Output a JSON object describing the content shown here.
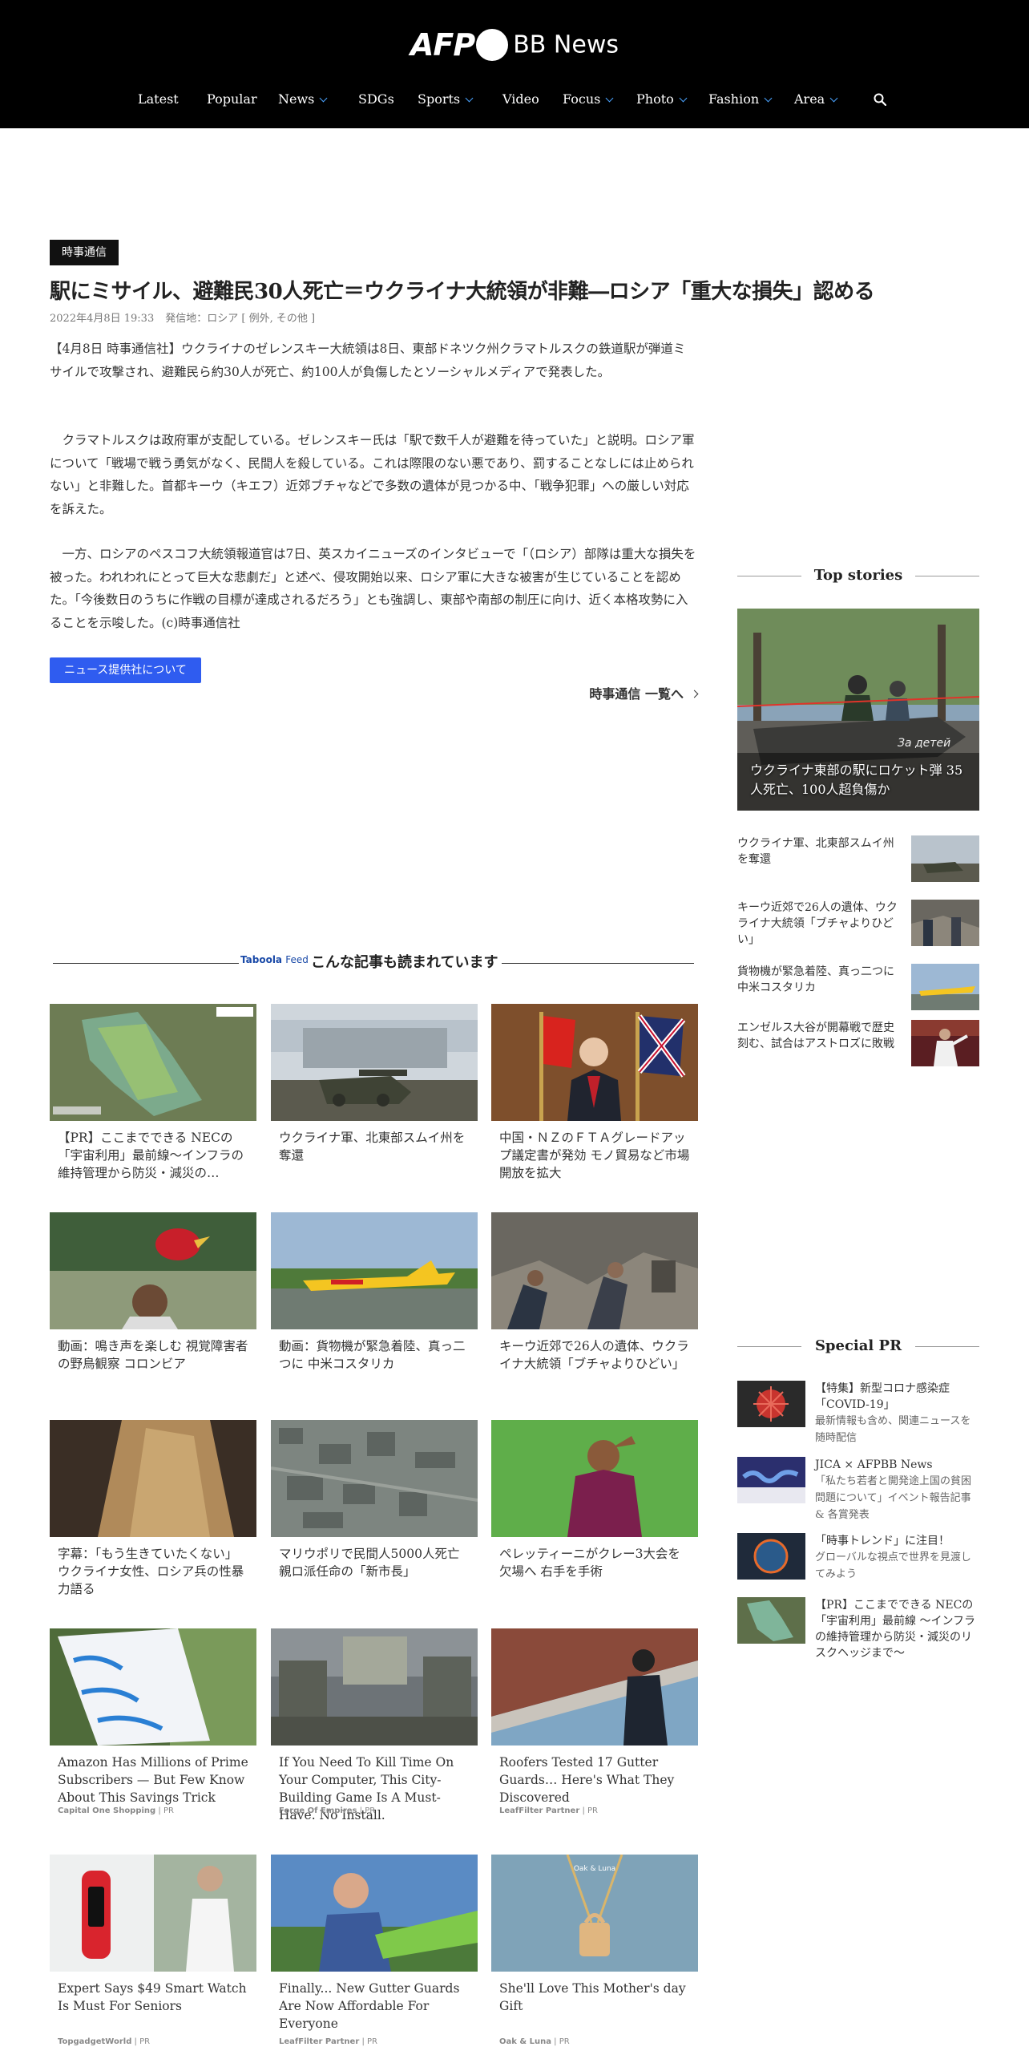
{
  "header": {
    "logo_afp": "AFP",
    "logo_bb": "BB News",
    "nav": [
      {
        "label": "Latest",
        "dropdown": false
      },
      {
        "label": "Popular",
        "dropdown": false
      },
      {
        "label": "News",
        "dropdown": true
      },
      {
        "label": "SDGs",
        "dropdown": false
      },
      {
        "label": "Sports",
        "dropdown": true
      },
      {
        "label": "Video",
        "dropdown": false
      },
      {
        "label": "Focus",
        "dropdown": true
      },
      {
        "label": "Photo",
        "dropdown": true
      },
      {
        "label": "Fashion",
        "dropdown": true
      },
      {
        "label": "Area",
        "dropdown": true
      }
    ],
    "search_icon": "search-icon"
  },
  "article": {
    "badge": "時事通信",
    "headline": "駅にミサイル、避難民30人死亡＝ウクライナ大統領が非難―ロシア「重大な損失」認める",
    "date": "2022年4月8日 19:33",
    "origin": "発信地：ロシア [ 例外, その他 ]",
    "paragraphs": [
      "【4月8日 時事通信社】ウクライナのゼレンスキー大統領は8日、東部ドネツク州クラマトルスクの鉄道駅が弾道ミサイルで攻撃され、避難民ら約30人が死亡、約100人が負傷したとソーシャルメディアで発表した。",
      "　クラマトルスクは政府軍が支配している。ゼレンスキー氏は「駅で数千人が避難を待っていた」と説明。ロシア軍について「戦場で戦う勇気がなく、民間人を殺している。これは際限のない悪であり、罰することなしには止められない」と非難した。首都キーウ（キエフ）近郊ブチャなどで多数の遺体が見つかる中、「戦争犯罪」への厳しい対応を訴えた。",
      "　一方、ロシアのペスコフ大統領報道官は7日、英スカイニューズのインタビューで「（ロシア）部隊は重大な損失を被った。われわれにとって巨大な悲劇だ」と述べ、侵攻開始以来、ロシア軍に大きな被害が生じていることを認めた。「今後数日のうちに作戦の目標が達成されるだろう」とも強調し、東部や南部の制圧に向け、近く本格攻勢に入ることを示唆した。(c)時事通信社"
    ],
    "provider_button": "ニュース提供社について",
    "list_link": "時事通信 一覧へ"
  },
  "feed": {
    "brand": "Taboola",
    "brand_suffix": "Feed",
    "title": "こんな記事も読まれています",
    "cards": [
      {
        "title": "【PR】ここまでできる NECの「宇宙利用」最前線～インフラの維持管理から防災・減災の…",
        "source": "",
        "thumb": "satellite-map"
      },
      {
        "title": "ウクライナ軍、北東部スムイ州を奪還",
        "source": "",
        "thumb": "tank"
      },
      {
        "title": "中国・ＮＺのＦＴＡグレードアップ議定書が発効 モノ貿易など市場開放を拡大",
        "source": "",
        "thumb": "official-flags"
      },
      {
        "title": "動画：鳴き声を楽しむ 視覚障害者の野鳥観察 コロンビア",
        "source": "",
        "thumb": "bird-boy"
      },
      {
        "title": "動画：貨物機が緊急着陸、真っ二つに 中米コスタリカ",
        "source": "",
        "thumb": "cargo-plane"
      },
      {
        "title": "キーウ近郊で26人の遺体、ウクライナ大統領「ブチャよりひどい」",
        "source": "",
        "thumb": "rubble"
      },
      {
        "title": "字幕：「もう生きていたくない」 ウクライナ女性、ロシア兵の性暴力語る",
        "source": "",
        "thumb": "woman-back"
      },
      {
        "title": "マリウポリで民間人5000人死亡 親ロ派任命の「新市長」",
        "source": "",
        "thumb": "aerial-city"
      },
      {
        "title": "ペレッティーニがクレー3大会を欠場へ 右手を手術",
        "source": "",
        "thumb": "tennis"
      },
      {
        "title": "Amazon Has Millions of Prime Subscribers — But Few Know About This Savings Trick",
        "source": "Capital One Shopping",
        "tag": "PR",
        "thumb": "prime-box"
      },
      {
        "title": "If You Need To Kill Time On Your Computer, This City-Building Game Is A Must-Have. No Install.",
        "source": "Forge Of Empires",
        "tag": "PR",
        "thumb": "game-city"
      },
      {
        "title": "Roofers Tested 17 Gutter Guards… Here's What They Discovered",
        "source": "LeafFilter Partner",
        "tag": "PR",
        "thumb": "roof"
      },
      {
        "title": "Expert Says $49 Smart Watch Is Must For Seniors",
        "source": "TopgadgetWorld",
        "tag": "PR",
        "thumb": "watch"
      },
      {
        "title": "Finally... New Gutter Guards Are Now Affordable For Everyone",
        "source": "LeafFilter Partner",
        "tag": "PR",
        "thumb": "gutter-man"
      },
      {
        "title": "She'll Love This Mother's day Gift",
        "source": "Oak & Luna",
        "tag": "PR",
        "thumb": "necklace",
        "thumb_text": "Oak & Luna"
      }
    ]
  },
  "sidebar": {
    "top_heading": "Top stories",
    "hero_caption": "ウクライナ東部の駅にロケット弾 35人死亡、100人超負傷か",
    "hero_graffiti": "За детей",
    "top_items": [
      {
        "title": "ウクライナ軍、北東部スムイ州を奪還"
      },
      {
        "title": "キーウ近郊で26人の遺体、ウクライナ大統領「ブチャよりひどい」"
      },
      {
        "title": "貨物機が緊急着陸、真っ二つに 中米コスタリカ"
      },
      {
        "title": "エンゼルス大谷が開幕戦で歴史刻む、試合はアストロズに敗戦"
      }
    ],
    "pr_heading": "Special PR",
    "pr_items": [
      {
        "title": "【特集】新型コロナ感染症「COVID-19」",
        "desc": "最新情報も含め、関連ニュースを随時配信"
      },
      {
        "title": "JICA × AFPBB News",
        "desc": "「私たち若者と開発途上国の貧困問題について」イベント報告記事 & 各賞発表"
      },
      {
        "title": "「時事トレンド」に注目！",
        "desc": "グローバルな視点で世界を見渡してみよう"
      },
      {
        "title": "【PR】ここまでできる NECの「宇宙利用」最前線 ～インフラの維持管理から防災・減災のリスクヘッジまで～",
        "desc": ""
      }
    ]
  },
  "colors": {
    "header_bg": "#000000",
    "accent_blue": "#2f5cf0",
    "chevron": "#4aa3ff"
  }
}
